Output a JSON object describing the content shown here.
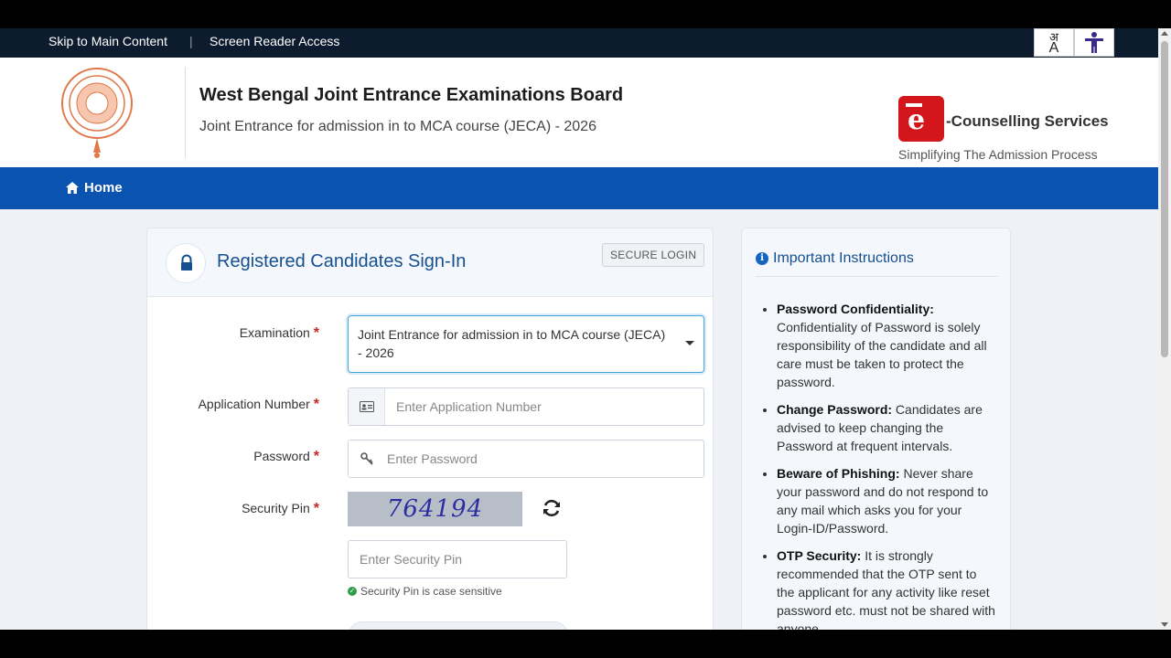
{
  "utility": {
    "skip_label": "Skip to Main Content",
    "separator": "|",
    "screen_reader_label": "Screen Reader Access",
    "lang_top": "अ",
    "lang_bottom": "A"
  },
  "header": {
    "org_title": "West Bengal Joint Entrance Examinations Board",
    "org_subtitle": "Joint Entrance for admission in to MCA course (JECA) - 2026",
    "ec_title": "-Counselling Services",
    "ec_tagline": "Simplifying The Admission Process"
  },
  "nav": {
    "home_label": "Home"
  },
  "signin": {
    "title": "Registered Candidates Sign-In",
    "badge": "SECURE LOGIN",
    "examination_label": "Examination",
    "examination_value": "Joint Entrance for admission in to MCA course (JECA) - 2026",
    "application_label": "Application Number",
    "application_placeholder": "Enter Application Number",
    "password_label": "Password",
    "password_placeholder": "Enter Password",
    "pin_label": "Security Pin",
    "captcha_text": "764194",
    "pin_placeholder": "Enter Security Pin",
    "pin_hint": "Security Pin is case sensitive",
    "required_mark": "*"
  },
  "instructions": {
    "title": "Important Instructions",
    "items": [
      {
        "heading": "Password Confidentiality:",
        "text": "Confidentiality of Password is solely responsibility of the candidate and all care must be taken to protect the password."
      },
      {
        "heading": "Change Password:",
        "text": "Candidates are advised to keep changing the Password at frequent intervals."
      },
      {
        "heading": "Beware of Phishing:",
        "text": "Never share your password and do not respond to any mail which asks you for your Login-ID/Password."
      },
      {
        "heading": "OTP Security:",
        "text": "It is strongly recommended that the OTP sent to the applicant for any activity like reset password etc. must not be shared with anyone."
      }
    ]
  },
  "colors": {
    "nav_bg": "#0b53b0",
    "title_blue": "#164f8f",
    "required_red": "#c62828",
    "brand_red": "#d2161b"
  },
  "icons": [
    "home-icon",
    "lock-icon",
    "id-card-icon",
    "key-icon",
    "refresh-icon",
    "check-circle-icon",
    "info-icon",
    "accessibility-icon",
    "language-icon",
    "caret-down-icon"
  ]
}
